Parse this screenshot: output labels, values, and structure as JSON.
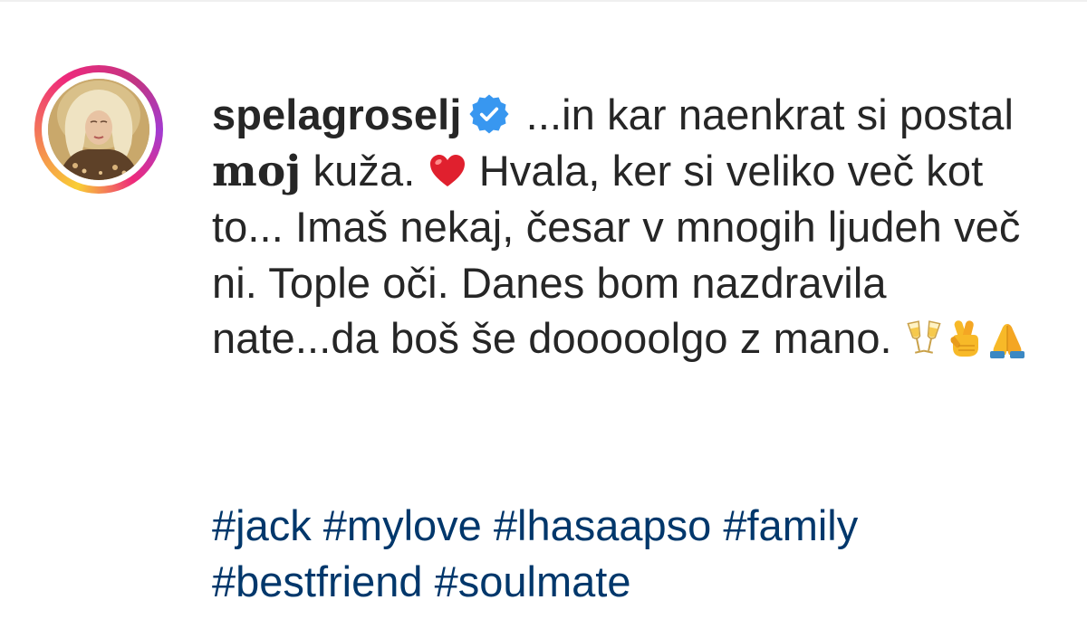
{
  "post": {
    "username": "spelagroselj",
    "verified": true,
    "caption": {
      "part1": " ...in kar naenkrat si postal ",
      "emphasis": "moj",
      "part2": " kuža. ",
      "part3": " Hvala, ker si veliko več kot to... Imaš nekaj, česar v mnogih ljudeh več ni. Tople oči. Danes bom nazdravila nate...da boš še dooooolgo z mano. ",
      "emojis": [
        "heart-emoji",
        "champagne-glasses-emoji",
        "crossed-fingers-emoji",
        "folded-hands-emoji"
      ]
    },
    "hashtags": [
      "#jack",
      "#mylove",
      "#lhasaapso",
      "#family",
      "#bestfriend",
      "#soulmate"
    ]
  },
  "colors": {
    "text": "#262626",
    "hashtag": "#00376b",
    "verified_badge": "#3897f0",
    "ring_start": "#f9ce34",
    "ring_mid": "#ee2a7b",
    "ring_end": "#a33bd1"
  }
}
